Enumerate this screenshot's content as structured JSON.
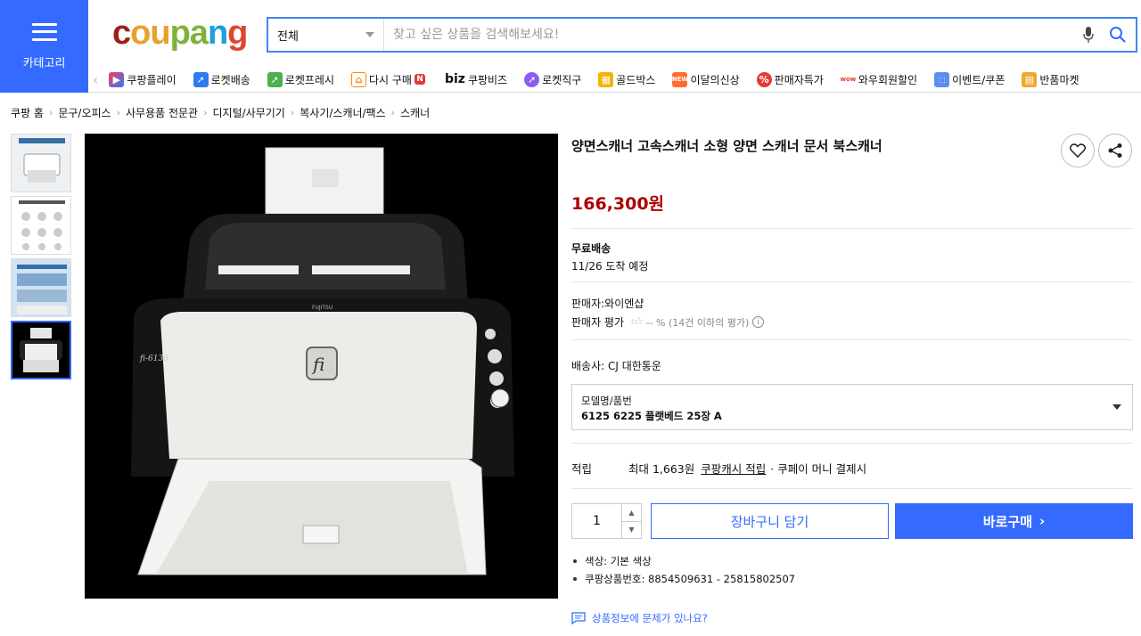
{
  "header": {
    "category_label": "카테고리",
    "logo": {
      "c": "c",
      "o": "ou",
      "p": "pa",
      "n": "n",
      "g": "g"
    },
    "search": {
      "category": "전체",
      "placeholder": "찾고 싶은 상품을 검색해보세요!"
    }
  },
  "nav": [
    {
      "label": "쿠팡플레이",
      "icon": "play-icon"
    },
    {
      "label": "로켓배송",
      "icon": "rocket-icon"
    },
    {
      "label": "로켓프레시",
      "icon": "rocket-fresh-icon"
    },
    {
      "label": "다시 구매",
      "icon": "rebuy-icon",
      "badge": "N"
    },
    {
      "label": "쿠팡비즈",
      "prefix": "biz",
      "icon": "biz-icon"
    },
    {
      "label": "로켓직구",
      "icon": "global-icon"
    },
    {
      "label": "골드박스",
      "icon": "goldbox-icon"
    },
    {
      "label": "이달의신상",
      "icon": "new-icon"
    },
    {
      "label": "판매자특가",
      "icon": "percent-icon"
    },
    {
      "label": "와우회원할인",
      "icon": "wow-icon"
    },
    {
      "label": "이벤트/쿠폰",
      "icon": "coupon-icon"
    },
    {
      "label": "반품마켓",
      "icon": "return-market-icon"
    }
  ],
  "breadcrumb": [
    "쿠팡 홈",
    "문구/오피스",
    "사무용품 전문관",
    "디지털/사무기기",
    "복사기/스캐너/팩스",
    "스캐너"
  ],
  "product": {
    "title": "양면스캐너 고속스캐너 소형 양면 스캐너 문서 북스캐너",
    "price": "166,300원",
    "shipping_title": "무료배송",
    "arrival": "11/26 도착 예정",
    "seller": "판매자:와이엔샵",
    "seller_rating_label": "판매자 평가",
    "seller_rating_value": "-- % (14건 이하의 평가)",
    "carrier": "배송사:  CJ 대한통운",
    "option_label": "모델명/품번",
    "option_value": "6125 6225 플랫베드 25장 A",
    "reward_label": "적립",
    "reward_prefix": "최대 1,663원",
    "reward_link": "쿠팡캐시 적립",
    "reward_suffix": "· 쿠페이 머니 결제시",
    "quantity": "1",
    "cart_label": "장바구니 담기",
    "buy_label": "바로구매",
    "bullets": [
      "색상: 기본 색상",
      "쿠팡상품번호: 8854509631 - 25815802507"
    ],
    "report_label": "상품정보에 문제가 있나요?"
  },
  "scanner_brand": {
    "maker": "FUJITSU",
    "logo": "fi",
    "model": "fi-6130"
  },
  "colors": {
    "accent": "#346aff",
    "price": "#ae0000"
  }
}
